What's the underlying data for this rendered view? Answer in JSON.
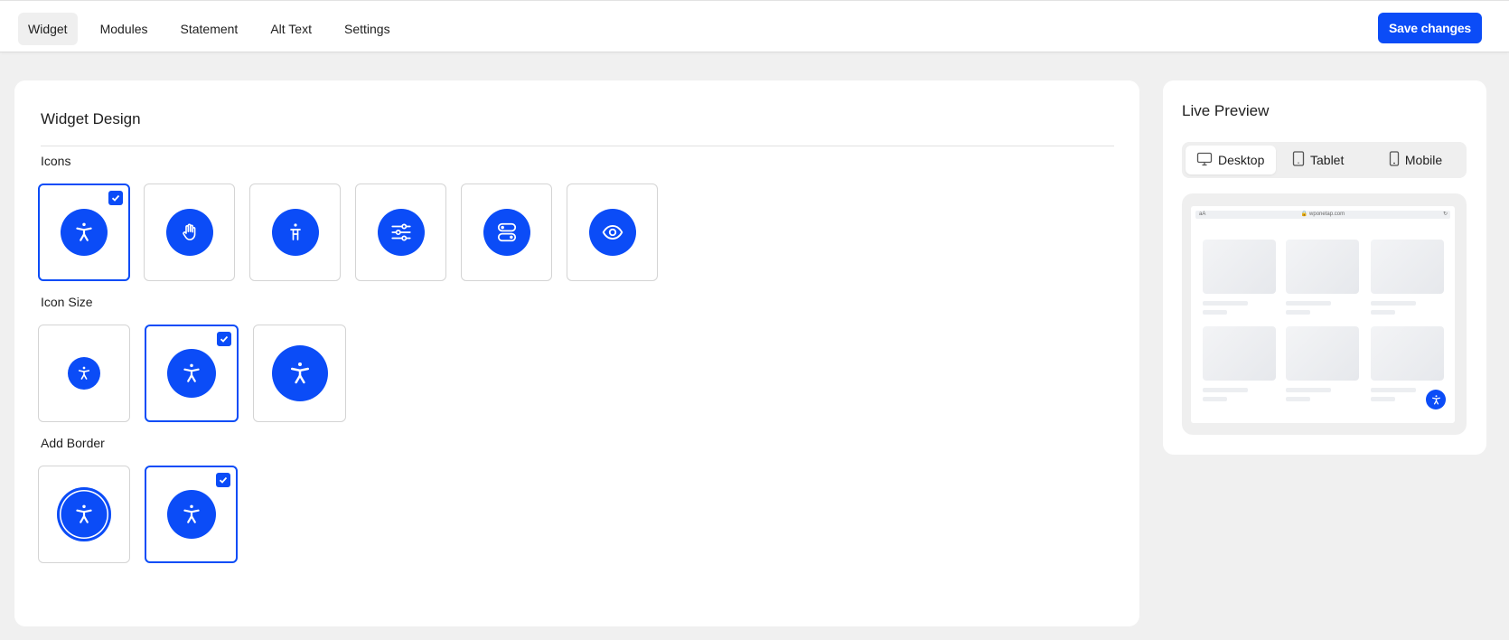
{
  "tabs": [
    {
      "label": "Widget",
      "active": true
    },
    {
      "label": "Modules",
      "active": false
    },
    {
      "label": "Statement",
      "active": false
    },
    {
      "label": "Alt Text",
      "active": false
    },
    {
      "label": "Settings",
      "active": false
    }
  ],
  "save_button": "Save changes",
  "colors": {
    "accent": "#0b4cf7",
    "background": "#f0f0f0"
  },
  "widget_design": {
    "title": "Widget Design",
    "icons": {
      "label": "Icons",
      "options": [
        {
          "icon": "accessibility-person-icon",
          "selected": true
        },
        {
          "icon": "hand-icon",
          "selected": false
        },
        {
          "icon": "accessibility-figure-icon",
          "selected": false
        },
        {
          "icon": "sliders-icon",
          "selected": false
        },
        {
          "icon": "toggles-icon",
          "selected": false
        },
        {
          "icon": "eye-icon",
          "selected": false
        }
      ]
    },
    "icon_size": {
      "label": "Icon Size",
      "options": [
        {
          "size": "small",
          "selected": false
        },
        {
          "size": "medium",
          "selected": true
        },
        {
          "size": "large",
          "selected": false
        }
      ]
    },
    "add_border": {
      "label": "Add Border",
      "options": [
        {
          "border": true,
          "selected": false
        },
        {
          "border": false,
          "selected": true
        }
      ]
    }
  },
  "live_preview": {
    "title": "Live Preview",
    "devices": [
      {
        "label": "Desktop",
        "icon": "monitor-icon",
        "active": true
      },
      {
        "label": "Tablet",
        "icon": "tablet-icon",
        "active": false
      },
      {
        "label": "Mobile",
        "icon": "phone-icon",
        "active": false
      }
    ],
    "browser": {
      "url": "wponetap.com",
      "text_size": "aA"
    }
  }
}
